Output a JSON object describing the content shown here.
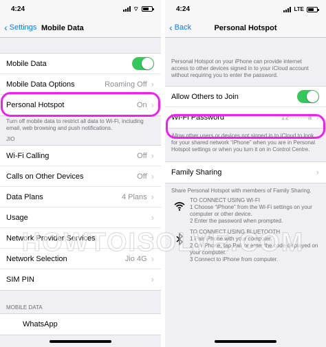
{
  "left": {
    "status": {
      "time": "4:24"
    },
    "nav": {
      "back_label": "Settings",
      "title": "Mobile Data"
    },
    "group1": [
      {
        "label": "Mobile Data",
        "toggle": true
      },
      {
        "label": "Mobile Data Options",
        "value": "Roaming Off",
        "chevron": true
      },
      {
        "label": "Personal Hotspot",
        "value": "On",
        "chevron": true
      }
    ],
    "group1_footer": "Turn off mobile data to restrict all data to Wi-Fi, including email, web browsing and push notifications.",
    "section_jio": "JIO",
    "group2": [
      {
        "label": "Wi-Fi Calling",
        "value": "Off"
      },
      {
        "label": "Calls on Other Devices",
        "value": "Off"
      },
      {
        "label": "Data Plans",
        "value": "4 Plans"
      },
      {
        "label": "Usage",
        "value": ""
      },
      {
        "label": "Network Provider Services",
        "value": ""
      },
      {
        "label": "Network Selection",
        "value": "Jio 4G"
      },
      {
        "label": "SIM PIN",
        "value": ""
      }
    ],
    "section_mobile_data": "MOBILE DATA",
    "partial_row": "WhatsApp"
  },
  "right": {
    "status": {
      "time": "4:24",
      "network": "LTE"
    },
    "nav": {
      "back_label": "Back",
      "title": "Personal Hotspot"
    },
    "intro": "Personal Hotspot on your iPhone can provide internet access to other devices signed in to your iCloud account without requiring you to enter the password.",
    "allow_label": "Allow Others to Join",
    "wifi_password_label": "Wi-Fi Password",
    "wifi_password_value": "12·······a",
    "allow_footer": "Allow other users or devices not signed in to iCloud to look for your shared network “iPhone” when you are in Personal Hotspot settings or when you turn it on in Control Centre.",
    "family_label": "Family Sharing",
    "family_footer": "Share Personal Hotspot with members of Family Sharing.",
    "wifi_connect": {
      "icon": "wifi-icon",
      "title": "TO CONNECT USING WI-FI",
      "step1": "1 Choose “iPhone” from the Wi-Fi settings on your computer or other device.",
      "step2": "2 Enter the password when prompted."
    },
    "bt_connect": {
      "icon": "bluetooth-icon",
      "title": "TO CONNECT USING BLUETOOTH",
      "step1": "1 Pair iPhone with your computer.",
      "step2": "2 On iPhone, tap Pair or enter the code displayed on your computer.",
      "step3": "3 Connect to iPhone from computer."
    }
  },
  "watermark": "HOWTOISOLVE.COM",
  "colors": {
    "accent": "#007aff",
    "toggle_on": "#34c759",
    "highlight": "#f01ff0"
  }
}
